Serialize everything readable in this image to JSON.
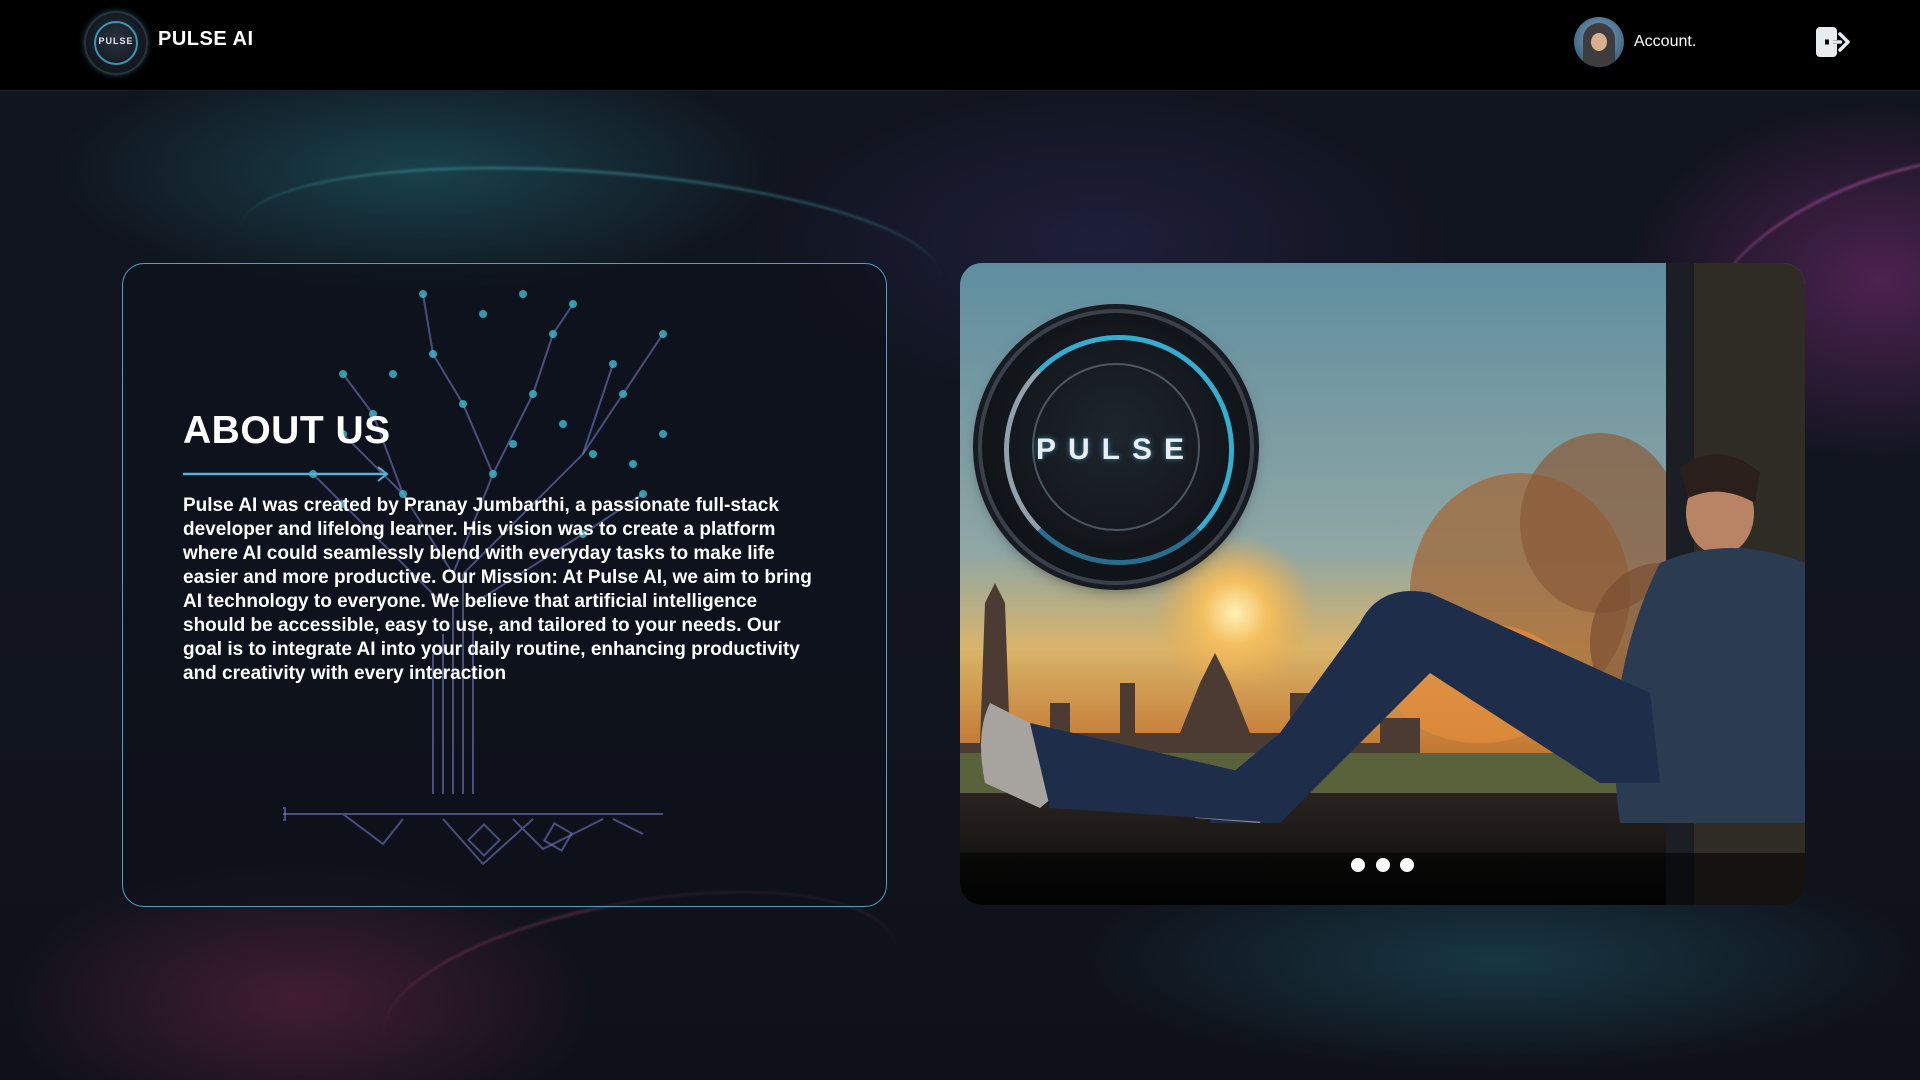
{
  "header": {
    "brand_name": "PULSE AI",
    "logo_icon": "pulse-logo-icon",
    "logo_text": "PULSE",
    "account_label": "Account.",
    "avatar_icon": "hooded-user-avatar",
    "logout_icon": "logout-icon"
  },
  "about": {
    "title": "ABOUT US",
    "body": "Pulse AI was created by Pranay Jumbarthi, a passionate full-stack developer and lifelong learner. His vision was to create a platform where AI could seamlessly blend with everyday tasks to make life easier and more productive. Our Mission: At Pulse AI, we aim to bring AI technology to everyone. We believe that artificial intelligence should be accessible, easy to use, and tailored to your needs. Our goal is to integrate AI into your daily routine, enhancing productivity and creativity with every interaction",
    "decoration_icon": "circuit-tree-icon"
  },
  "slider": {
    "logo_text": "PULSE",
    "image_description_icon": "man-at-window-city-painting",
    "dots": 3,
    "active_dot": 0
  },
  "colors": {
    "accent": "#4aa3c4",
    "header_bg": "#000000",
    "page_bg": "#10141d"
  }
}
